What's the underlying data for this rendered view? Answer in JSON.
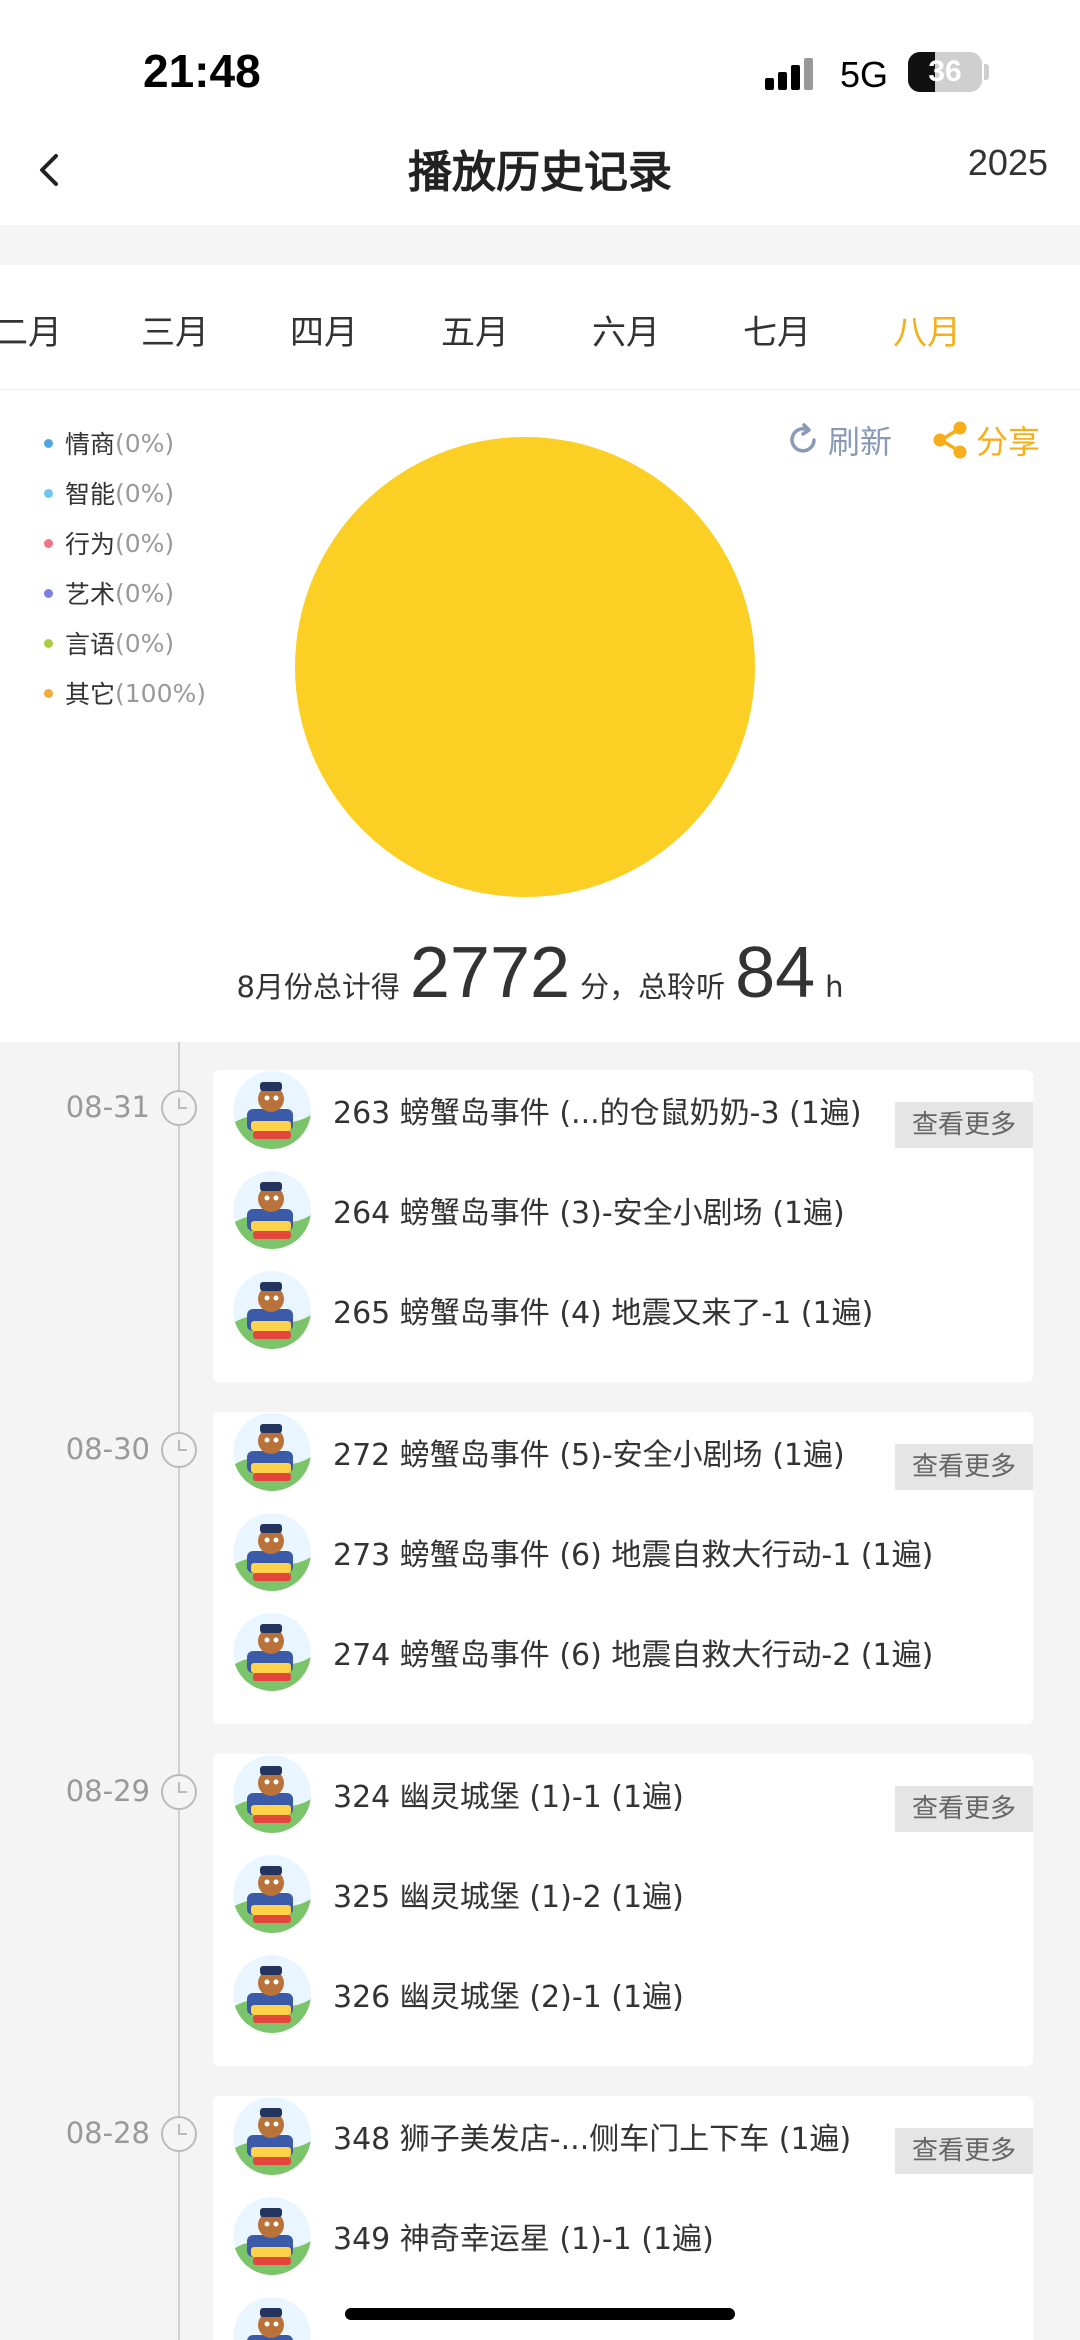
{
  "status_bar": {
    "time": "21:48",
    "network": "5G",
    "battery": "36",
    "battery_level": 0.36
  },
  "nav": {
    "title": "播放历史记录",
    "year": "2025"
  },
  "months": [
    "二月",
    "三月",
    "四月",
    "五月",
    "六月",
    "七月",
    "八月"
  ],
  "active_month": "八月",
  "legend": [
    {
      "name": "情商",
      "pct": "(0%)",
      "color": "#4ea8e6"
    },
    {
      "name": "智能",
      "pct": "(0%)",
      "color": "#6cc7f0"
    },
    {
      "name": "行为",
      "pct": "(0%)",
      "color": "#f0738a"
    },
    {
      "name": "艺术",
      "pct": "(0%)",
      "color": "#7b7fe6"
    },
    {
      "name": "言语",
      "pct": "(0%)",
      "color": "#a8cf3c"
    },
    {
      "name": "其它",
      "pct": "(100%)",
      "color": "#f6a93b"
    }
  ],
  "actions": {
    "refresh": "刷新",
    "share": "分享"
  },
  "pie": {
    "color": "#fbcf24",
    "share_percent": 100
  },
  "summary": {
    "prefix": "8月份总计得",
    "score": "2772",
    "mid": "分，总聆听",
    "hours": "84",
    "unit": "h"
  },
  "more_label": "查看更多",
  "days": [
    {
      "date": "08-31",
      "items": [
        "263 螃蟹岛事件 (...的仓鼠奶奶-3 (1遍)",
        "264 螃蟹岛事件 (3)-安全小剧场 (1遍)",
        "265 螃蟹岛事件 (4) 地震又来了-1 (1遍)"
      ]
    },
    {
      "date": "08-30",
      "items": [
        "272 螃蟹岛事件 (5)-安全小剧场 (1遍)",
        "273 螃蟹岛事件 (6) 地震自救大行动-1 (1遍)",
        "274 螃蟹岛事件 (6) 地震自救大行动-2 (1遍)"
      ]
    },
    {
      "date": "08-29",
      "items": [
        "324 幽灵城堡 (1)-1 (1遍)",
        "325 幽灵城堡 (1)-2 (1遍)",
        "326 幽灵城堡 (2)-1 (1遍)"
      ]
    },
    {
      "date": "08-28",
      "items": [
        "348 狮子美发店-...侧车门上下车 (1遍)",
        "349 神奇幸运星 (1)-1 (1遍)",
        ""
      ]
    }
  ]
}
